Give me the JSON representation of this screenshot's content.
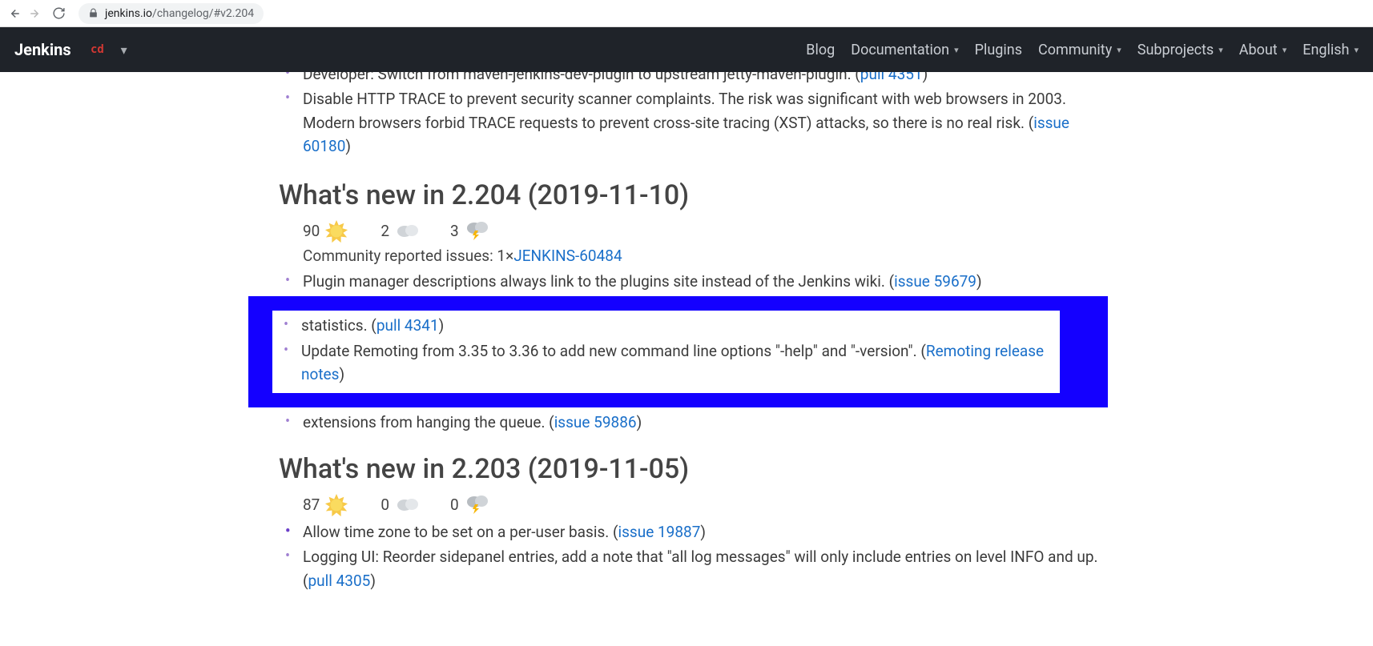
{
  "browser": {
    "url_host": "jenkins.io",
    "url_path": "/changelog/",
    "url_fragment": "#v2.204"
  },
  "nav": {
    "brand": "Jenkins",
    "items": [
      {
        "label": "Blog",
        "dropdown": false
      },
      {
        "label": "Documentation",
        "dropdown": true
      },
      {
        "label": "Plugins",
        "dropdown": false
      },
      {
        "label": "Community",
        "dropdown": true
      },
      {
        "label": "Subprojects",
        "dropdown": true
      },
      {
        "label": "About",
        "dropdown": true
      },
      {
        "label": "English",
        "dropdown": true
      }
    ]
  },
  "top_items": [
    {
      "text_before": "Developer: Switch from maven-jenkins-dev-plugin to upstream jetty-maven-plugin. (",
      "link": "pull 4351",
      "text_after": ")"
    },
    {
      "text_before": "Disable HTTP TRACE to prevent security scanner complaints. The risk was significant with web browsers in 2003. Modern browsers forbid TRACE requests to prevent cross-site tracing (XST) attacks, so there is no real risk. (",
      "link": "issue 60180",
      "text_after": ")"
    }
  ],
  "section204": {
    "heading": "What's new in 2.204 (2019-11-10)",
    "ratings": {
      "sunny": "90",
      "cloudy": "2",
      "storm": "3"
    },
    "issues_label": "Community reported issues: 1×",
    "issues_link": "JENKINS-60484",
    "pre_highlight": [
      {
        "text_before": "Plugin manager descriptions always link to the plugins site instead of the Jenkins wiki. (",
        "link": "issue 59679",
        "text_after": ")"
      }
    ],
    "highlight": {
      "partial_top": {
        "text_before": "statistics. (",
        "link": "pull 4341",
        "text_after": ")"
      },
      "middle": {
        "text_before": "Update Remoting from 3.35 to 3.36 to add new command line options \"-help\" and \"-version\". (",
        "link": "Remoting release notes",
        "text_after": ")"
      }
    },
    "post_highlight": [
      {
        "text_before": "extensions from hanging the queue. (",
        "link": "issue 59886",
        "text_after": ")"
      }
    ]
  },
  "section203": {
    "heading": "What's new in 2.203 (2019-11-05)",
    "ratings": {
      "sunny": "87",
      "cloudy": "0",
      "storm": "0"
    },
    "items": [
      {
        "strong": true,
        "text_before": "Allow time zone to be set on a per-user basis. (",
        "link": "issue 19887",
        "text_after": ")"
      },
      {
        "strong": false,
        "text_before": "Logging UI: Reorder sidepanel entries, add a note that \"all log messages\" will only include entries on level INFO and up. (",
        "link": "pull 4305",
        "text_after": ")"
      }
    ]
  }
}
